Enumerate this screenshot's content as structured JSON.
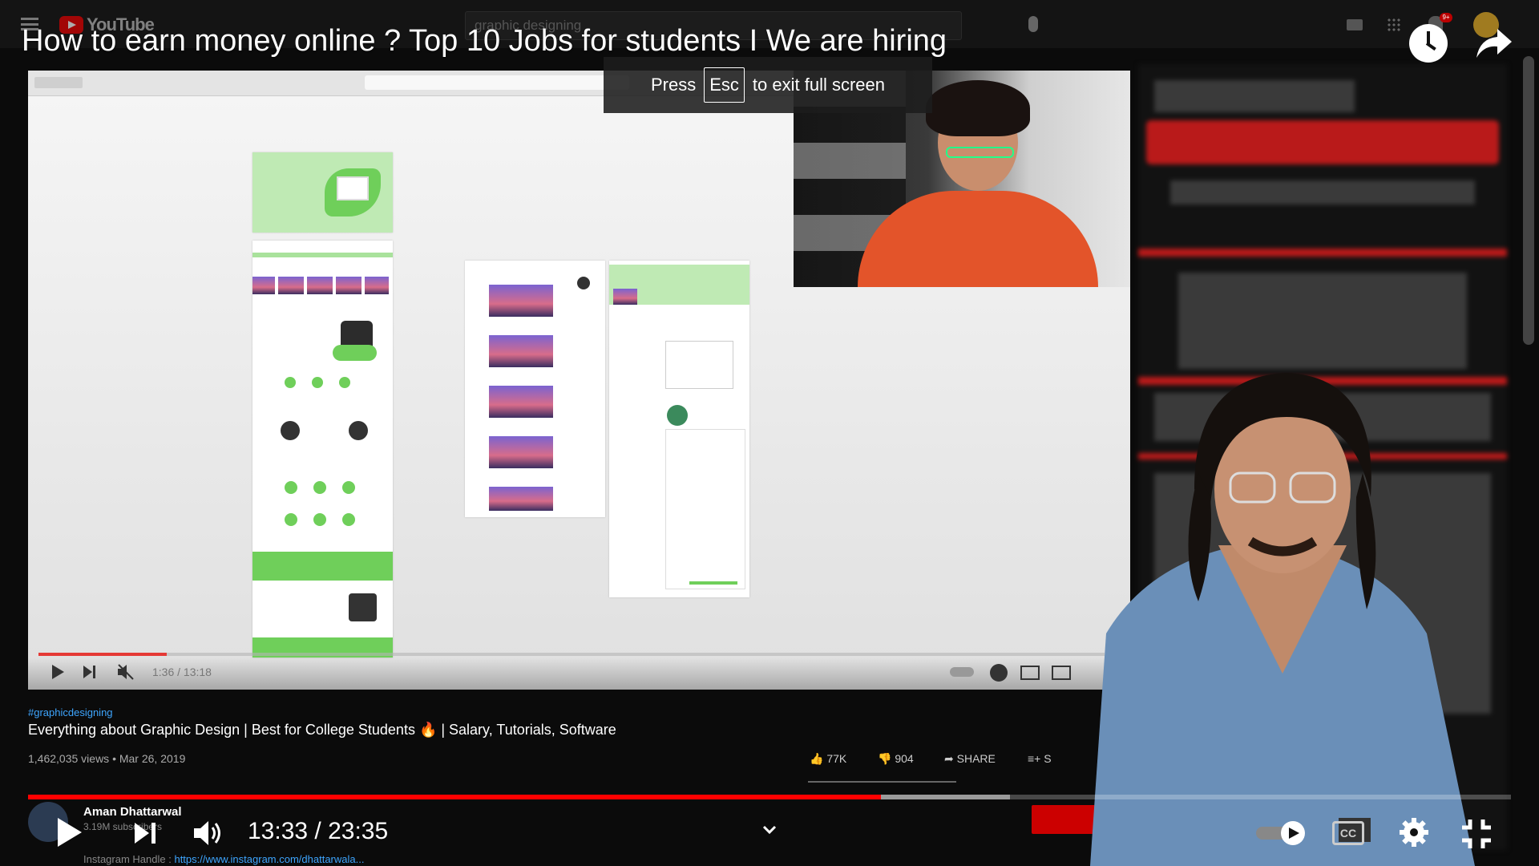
{
  "youtube_bar": {
    "logo_text": "YouTube",
    "search_text": "graphic designing",
    "notification_count": "9+"
  },
  "fullscreen": {
    "title": "How to earn money online ? Top 10 Jobs for students I We are hiring",
    "esc_prefix": "Press",
    "esc_key": "Esc",
    "esc_suffix": "to exit full screen"
  },
  "embedded_player": {
    "time": "1:36 / 13:18",
    "progress_fraction": 0.12
  },
  "embedded_info": {
    "hashtag": "#graphicdesigning",
    "title": "Everything about Graphic Design | Best for College Students 🔥 | Salary, Tutorials, Software",
    "views_date": "1,462,035 views • Mar 26, 2019",
    "likes": "77K",
    "dislikes": "904",
    "share_label": "SHARE",
    "save_label": "S",
    "channel_name": "Aman Dhattarwal",
    "subscribers": "3.19M subscribers",
    "insta_label": "Instagram Handle :",
    "insta_url": "https://www.instagram.com/dhattarwala..."
  },
  "player": {
    "time_display": "13:33 / 23:35",
    "progress_fraction": 0.575,
    "buffer_fraction": 0.662,
    "cc_label": "CC"
  },
  "colors": {
    "progress": "#ff0000",
    "embed_progress": "#e53935",
    "link": "#3ea6ff"
  }
}
